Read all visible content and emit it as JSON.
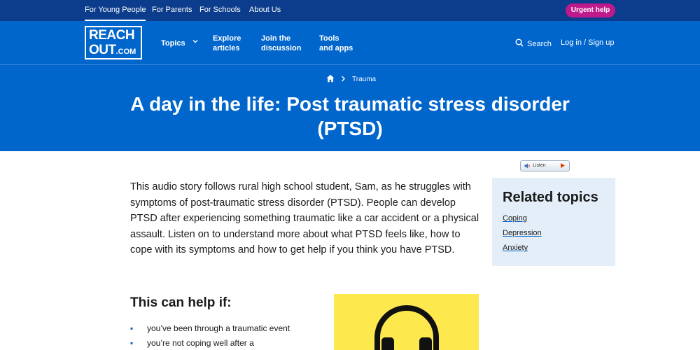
{
  "topbar": {
    "audiences": [
      "For Young People",
      "For Parents",
      "For Schools",
      "About Us"
    ],
    "urgent_label": "Urgent help"
  },
  "logo": {
    "line1": "REACH",
    "line2": "OUT",
    "suffix": ".COM"
  },
  "nav": {
    "topics": "Topics",
    "explore_line1": "Explore",
    "explore_line2": "articles",
    "join_line1": "Join the",
    "join_line2": "discussion",
    "tools_line1": "Tools",
    "tools_line2": "and apps",
    "search_label": "Search",
    "login_label": "Log in / Sign up"
  },
  "breadcrumb": {
    "current": "Trauma"
  },
  "page": {
    "title": "A day in the life: Post traumatic stress disorder (PTSD)",
    "intro": "This audio story follows rural high school student, Sam, as he struggles with symptoms of post-traumatic stress disorder (PTSD). People can develop PTSD after experiencing something traumatic like a car accident or a physical assault. Listen on to understand more about what PTSD feels like, how to cope with its symptoms and how to get help if you think you have PTSD.",
    "listen_label": "Listen",
    "help_heading": "This can help if:",
    "bullets": [
      "you’ve been through a traumatic event",
      "you’re not coping well after a"
    ]
  },
  "related": {
    "heading": "Related topics",
    "links": [
      "Coping",
      "Depression",
      "Anxiety"
    ]
  },
  "colors": {
    "topbar": "#0b3d8c",
    "brand_blue": "#0066cc",
    "urgent": "#c0198c",
    "related_bg": "#e3eef8",
    "promo_bg": "#fde84e"
  },
  "icons": {
    "home": "home-icon",
    "search": "search-icon",
    "chevron": "chevron-down-icon",
    "speaker": "speaker-icon",
    "play": "play-icon",
    "headphones": "headphones-icon"
  }
}
